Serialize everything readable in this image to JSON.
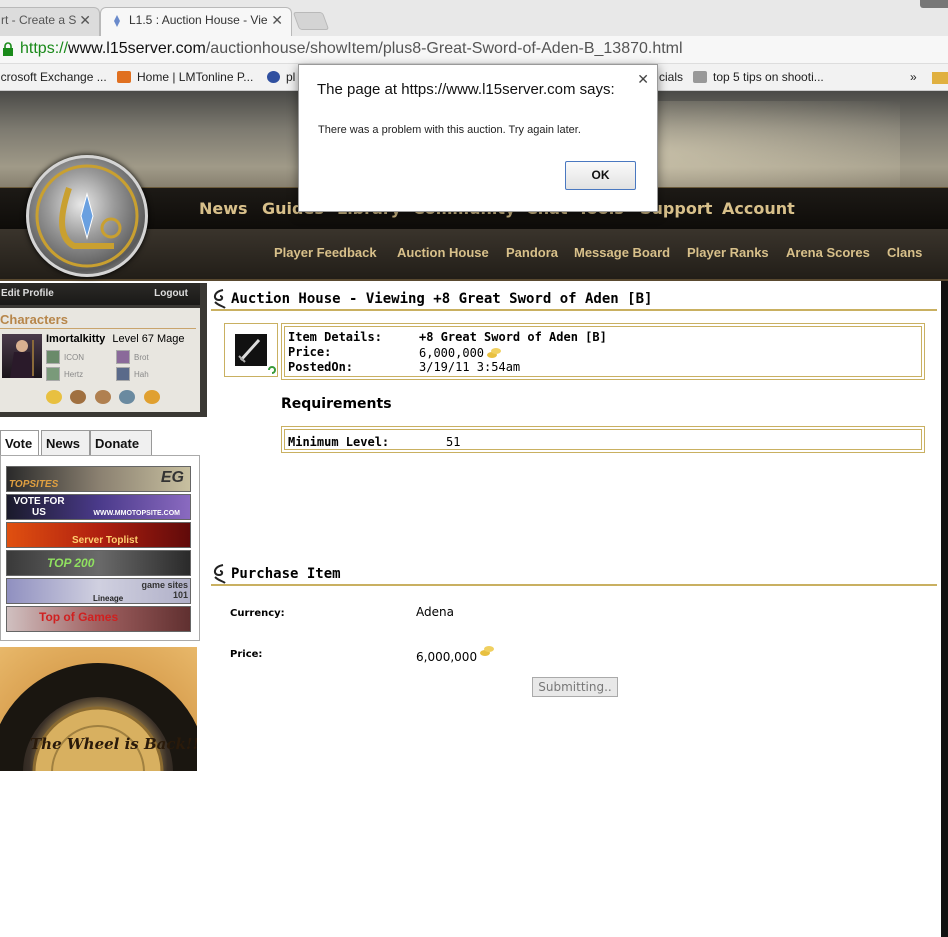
{
  "browser": {
    "tabs": [
      {
        "label": "rt - Create a S",
        "active": false
      },
      {
        "label": "L1.5 : Auction House - Vie",
        "active": true
      }
    ],
    "url": {
      "scheme": "https://",
      "host": "www.l15server.com",
      "path": "/auctionhouse/showItem/plus8-Great-Sword-of-Aden-B_13870.html"
    },
    "bookmarks": [
      {
        "label": "icrosoft Exchange ...",
        "icon": "exchange-icon"
      },
      {
        "label": "Home | LMTonline P...",
        "icon": "lmtonline-icon"
      },
      {
        "label": "pl",
        "icon": "globe-icon"
      },
      {
        "label": "cials",
        "icon": "none"
      },
      {
        "label": "top 5 tips on shooti...",
        "icon": "tips-icon"
      },
      {
        "label": "»",
        "icon": "none"
      }
    ]
  },
  "site": {
    "nav_main": [
      "News",
      "Guides",
      "Library",
      "Community",
      "Chat",
      "Tools",
      "Support",
      "Account"
    ],
    "nav_sub": [
      "Player Feedback",
      "Auction House",
      "Pandora",
      "Message Board",
      "Player Ranks",
      "Arena Scores",
      "Clans"
    ]
  },
  "left": {
    "edit_profile": "Edit Profile",
    "logout": "Logout",
    "characters_title": "Characters",
    "char_name": "Imortalkitty",
    "char_level": "Level 67 Mage",
    "alts": [
      "ICON",
      "Brot",
      "Hertz",
      "Hah"
    ],
    "tabs": [
      "Vote",
      "News",
      "Donate"
    ],
    "vote_buttons": [
      {
        "label": "TOPSITES",
        "extra": "EG"
      },
      {
        "label": "VOTE FOR US",
        "extra": "WWW.MMOTOPSITE.COM"
      },
      {
        "label": "Server Toplist",
        "extra": ""
      },
      {
        "label": "TOP 200",
        "extra": ""
      },
      {
        "label": "Lineage",
        "extra": "game sites 101"
      },
      {
        "label": "Top of Games",
        "extra": ""
      }
    ],
    "wheel_text": "The Wheel is Back!!"
  },
  "main": {
    "header": "Auction House - Viewing +8 Great Sword of Aden [B]",
    "details": {
      "item_details_label": "Item Details:",
      "item_name": "+8 Great Sword of Aden [B]",
      "price_label": "Price:",
      "price": "6,000,000",
      "posted_label": "PostedOn:",
      "posted": "3/19/11 3:54am"
    },
    "requirements_title": "Requirements",
    "min_level_label": "Minimum Level:",
    "min_level": "51",
    "purchase_header": "Purchase Item",
    "currency_label": "Currency:",
    "currency": "Adena",
    "price_label": "Price:",
    "price": "6,000,000",
    "submit_label": "Submitting.."
  },
  "dialog": {
    "title": "The page at https://www.l15server.com says:",
    "message": "There was a problem with this auction. Try again later.",
    "ok_label": "OK"
  }
}
